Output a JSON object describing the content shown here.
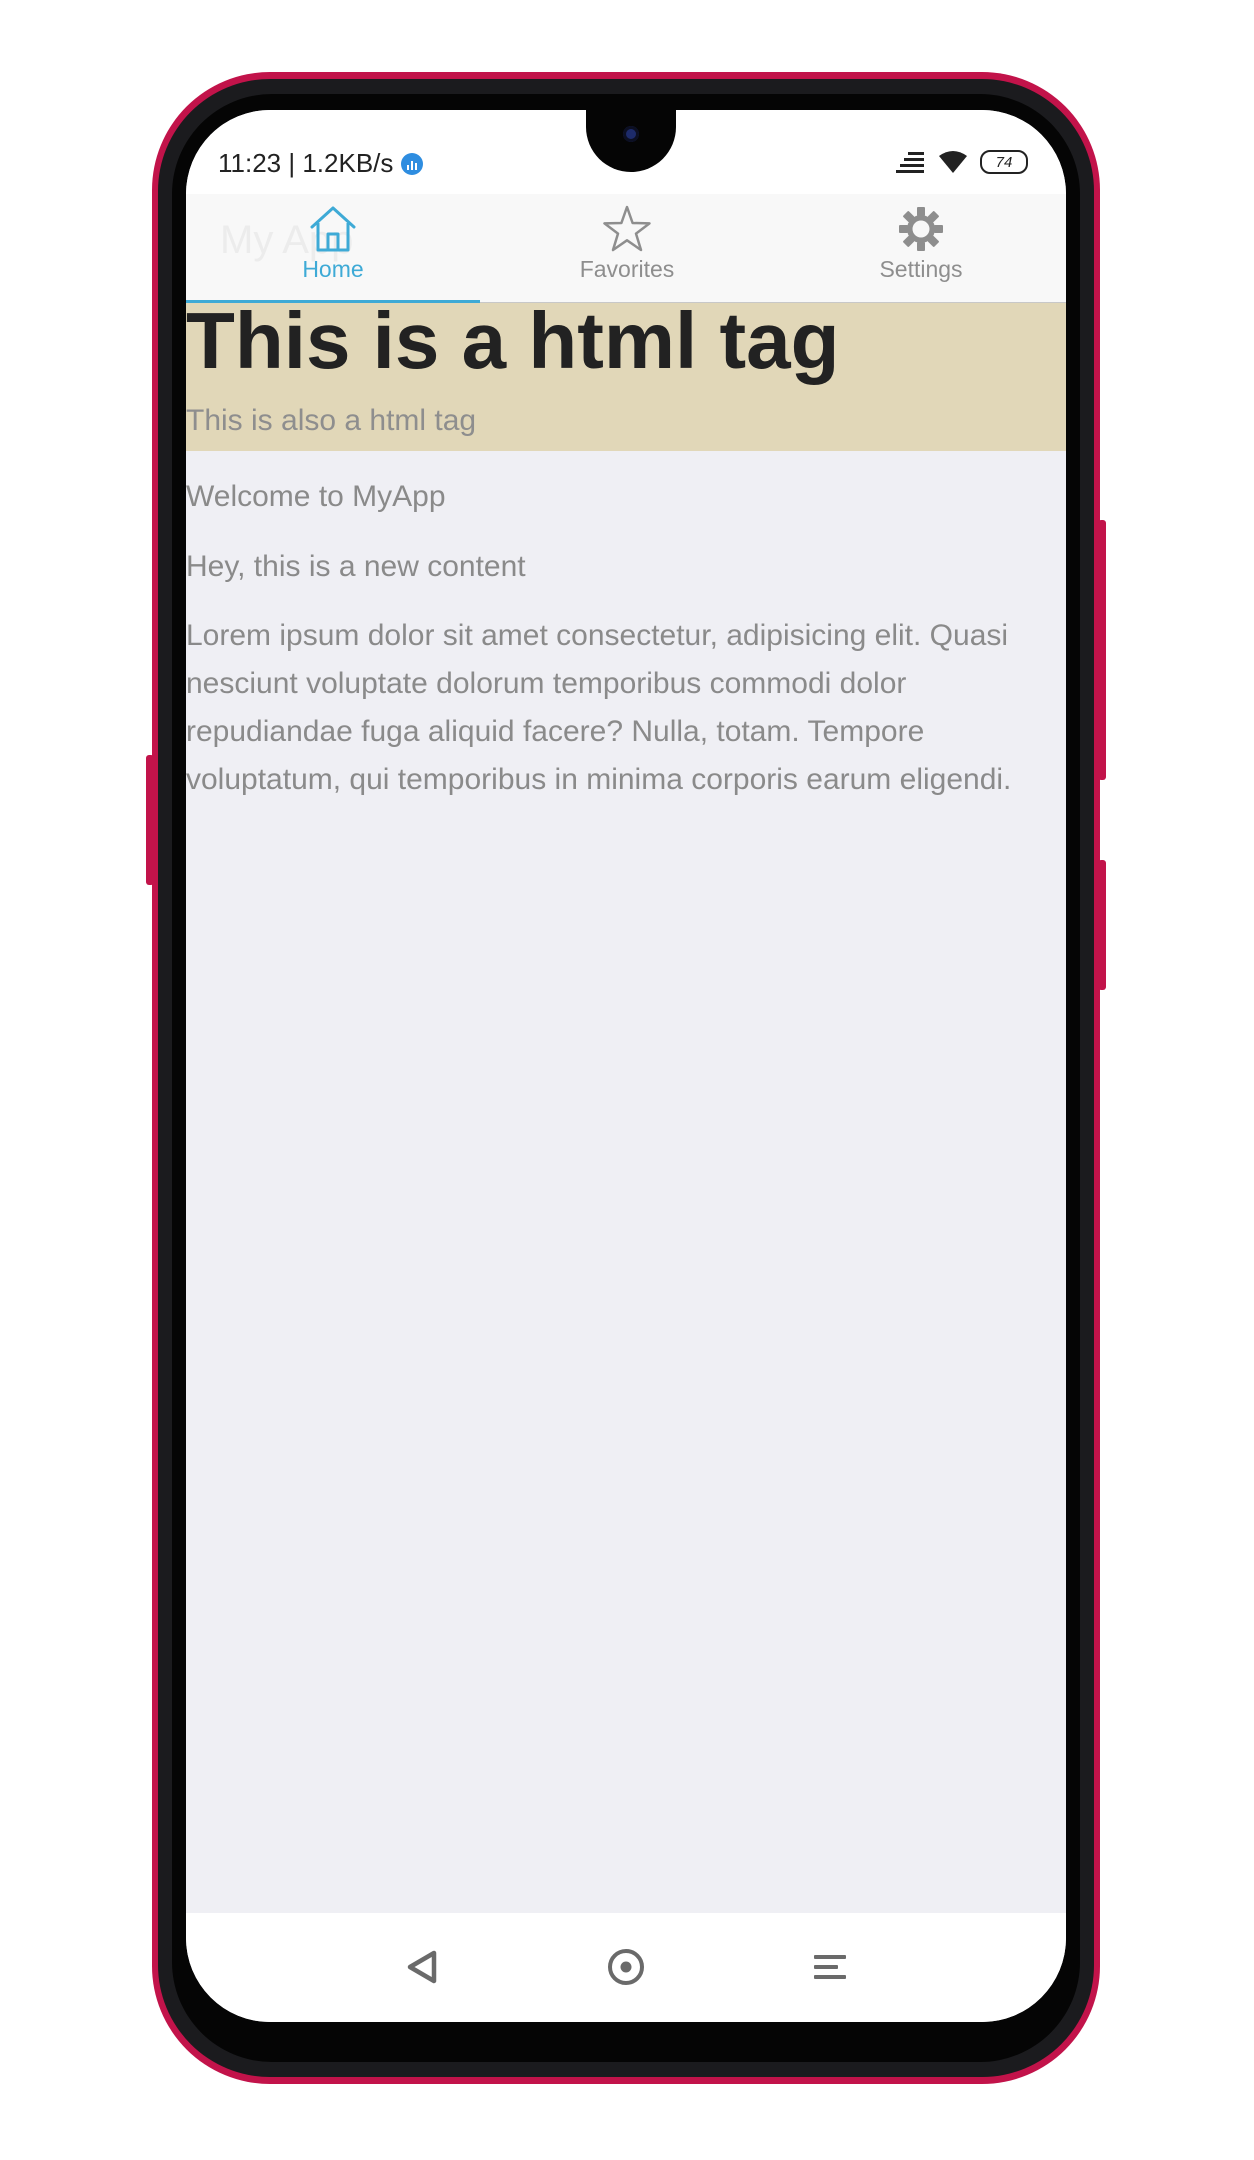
{
  "status_bar": {
    "time_speed": "11:23 | 1.2KB/s",
    "battery": "74"
  },
  "app": {
    "title": "My App"
  },
  "tabs": [
    {
      "label": "Home",
      "icon": "home-icon",
      "active": true
    },
    {
      "label": "Favorites",
      "icon": "star-icon",
      "active": false
    },
    {
      "label": "Settings",
      "icon": "gear-icon",
      "active": false
    }
  ],
  "hero": {
    "title": "This is a html tag",
    "subtitle": "This is also a html tag"
  },
  "content": {
    "welcome": "Welcome to MyApp",
    "new_content": "Hey, this is a new content",
    "lorem": "Lorem ipsum dolor sit amet consectetur, adipisicing elit. Quasi nesciunt voluptate dolorum temporibus commodi dolor repudiandae fuga aliquid facere? Nulla, totam. Tempore voluptatum, qui temporibus in minima corporis earum eligendi."
  },
  "navigation": [
    "back-icon",
    "home-circle-icon",
    "menu-icon"
  ],
  "colors": {
    "accent": "#3eaad6",
    "hero_background": "#e1d7b8",
    "page_background": "#efeff4",
    "phone_frame": "#c2134a"
  }
}
